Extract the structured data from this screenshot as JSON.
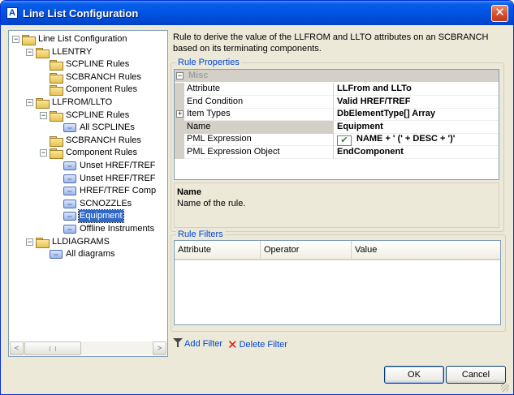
{
  "window": {
    "title": "Line List Configuration",
    "close_glyph": "✕",
    "app_icon_glyph": "A"
  },
  "tree": {
    "items": [
      {
        "label": "Line List Configuration",
        "icon": "folder-icon",
        "level": 0,
        "expander": "−"
      },
      {
        "label": "LLENTRY",
        "icon": "folder-icon",
        "level": 1,
        "expander": "−"
      },
      {
        "label": "SCPLINE Rules",
        "icon": "folder-icon",
        "level": 2
      },
      {
        "label": "SCBRANCH Rules",
        "icon": "folder-icon",
        "level": 2
      },
      {
        "label": "Component Rules",
        "icon": "folder-icon",
        "level": 2
      },
      {
        "label": "LLFROM/LLTO",
        "icon": "folder-icon",
        "level": 1,
        "expander": "−"
      },
      {
        "label": "SCPLINE Rules",
        "icon": "folder-icon",
        "level": 2,
        "expander": "−"
      },
      {
        "label": "All SCPLINEs",
        "icon": "rule-icon",
        "level": 3
      },
      {
        "label": "SCBRANCH Rules",
        "icon": "folder-icon",
        "level": 2
      },
      {
        "label": "Component Rules",
        "icon": "folder-icon",
        "level": 2,
        "expander": "−"
      },
      {
        "label": "Unset HREF/TREF",
        "icon": "rule-icon",
        "level": 3
      },
      {
        "label": "Unset HREF/TREF",
        "icon": "rule-icon",
        "level": 3
      },
      {
        "label": "HREF/TREF Comp",
        "icon": "rule-icon",
        "level": 3
      },
      {
        "label": "SCNOZZLEs",
        "icon": "rule-icon",
        "level": 3
      },
      {
        "label": "Equipment",
        "icon": "rule-icon",
        "level": 3,
        "selected": true
      },
      {
        "label": "Offline Instruments",
        "icon": "rule-icon",
        "level": 3
      },
      {
        "label": "LLDIAGRAMS",
        "icon": "folder-icon",
        "level": 1,
        "expander": "−"
      },
      {
        "label": "All diagrams",
        "icon": "rule-icon",
        "level": 2
      }
    ],
    "scroll_left_glyph": "<",
    "scroll_right_glyph": ">"
  },
  "description": "Rule to derive the value of the LLFROM and LLTO attributes on an SCBRANCH based on its terminating components.",
  "rule_properties": {
    "group_title": "Rule Properties",
    "category": "Misc",
    "category_expander": "−",
    "rows": [
      {
        "name": "Attribute",
        "value": "LLFrom and LLTo"
      },
      {
        "name": "End Condition",
        "value": "Valid HREF/TREF"
      },
      {
        "name": "Item Types",
        "value": "DbElementType[] Array",
        "expander": "+"
      },
      {
        "name": "Name",
        "value": "Equipment",
        "selected": true
      },
      {
        "name": "PML Expression",
        "value": "NAME + ' (' + DESC + ')'",
        "icon": "checkmark-icon"
      },
      {
        "name": "PML Expression Object",
        "value": "EndComponent"
      }
    ],
    "help_title": "Name",
    "help_text": "Name of the rule."
  },
  "rule_filters": {
    "group_title": "Rule Filters",
    "columns": [
      "Attribute",
      "Operator",
      "Value"
    ],
    "add_label": "Add Filter",
    "delete_label": "Delete Filter"
  },
  "buttons": {
    "ok": "OK",
    "cancel": "Cancel"
  }
}
